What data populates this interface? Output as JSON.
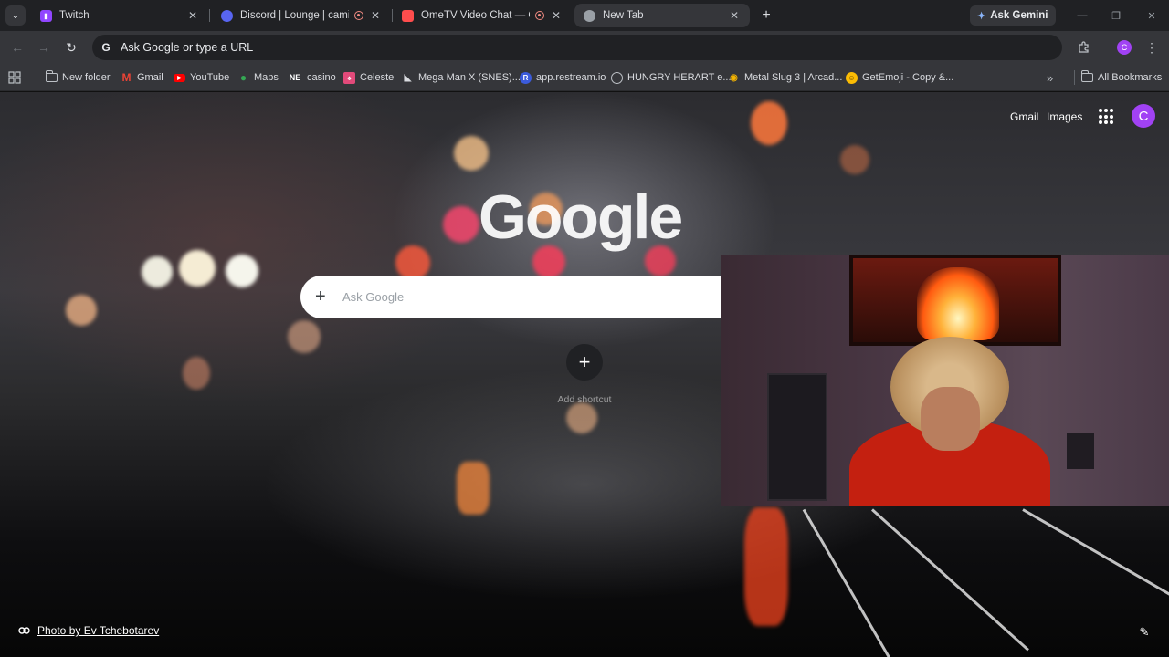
{
  "tabs": [
    {
      "title": "Twitch",
      "favicon": "twitch-icon",
      "color": "#9146ff",
      "recording": false,
      "active": false
    },
    {
      "title": "Discord | Lounge | camilosy",
      "favicon": "discord-icon",
      "color": "#5865f2",
      "recording": true,
      "active": false
    },
    {
      "title": "OmeTV Video Chat — Ome",
      "favicon": "ometv-icon",
      "color": "#ff4d4d",
      "recording": true,
      "active": false
    },
    {
      "title": "New Tab",
      "favicon": "chrome-icon",
      "color": "#9aa0a6",
      "recording": false,
      "active": true
    }
  ],
  "gemini_label": "Ask Gemini",
  "omnibox": {
    "placeholder": "Ask Google or type a URL"
  },
  "profile_initial": "C",
  "bookmarks": [
    {
      "label": "New folder",
      "icon": "folder-icon",
      "color": "#bdc1c6"
    },
    {
      "label": "Gmail",
      "icon": "gmail-icon",
      "color": "#ea4335"
    },
    {
      "label": "YouTube",
      "icon": "youtube-icon",
      "color": "#ff0000"
    },
    {
      "label": "Maps",
      "icon": "maps-icon",
      "color": "#34a853"
    },
    {
      "label": "casino",
      "icon": "ne-icon",
      "color": "#ffffff"
    },
    {
      "label": "Celeste",
      "icon": "celeste-icon",
      "color": "#e24a7a"
    },
    {
      "label": "Mega Man X (SNES)...",
      "icon": "megaman-icon",
      "color": "#5b6ee1"
    },
    {
      "label": "app.restream.io",
      "icon": "restream-icon",
      "color": "#3b5bdb"
    },
    {
      "label": "HUNGRY HERART e...",
      "icon": "hungry-icon",
      "color": "#bdc1c6"
    },
    {
      "label": "Metal Slug 3 | Arcad...",
      "icon": "metalslug-icon",
      "color": "#f4b400"
    },
    {
      "label": "GetEmoji - Copy &...",
      "icon": "emoji-icon",
      "color": "#fbbc04"
    }
  ],
  "all_bookmarks_label": "All Bookmarks",
  "ntp": {
    "gmail_link": "Gmail",
    "images_link": "Images",
    "logo_text": "Google",
    "search_placeholder": "Ask Google",
    "add_shortcut_label": "Add shortcut",
    "avatar_initial": "C",
    "photo_credit": "Photo by Ev Tchebotarev"
  },
  "colors": {
    "chrome_dark": "#202124",
    "toolbar": "#35363a",
    "accent_purple": "#a142f4"
  }
}
